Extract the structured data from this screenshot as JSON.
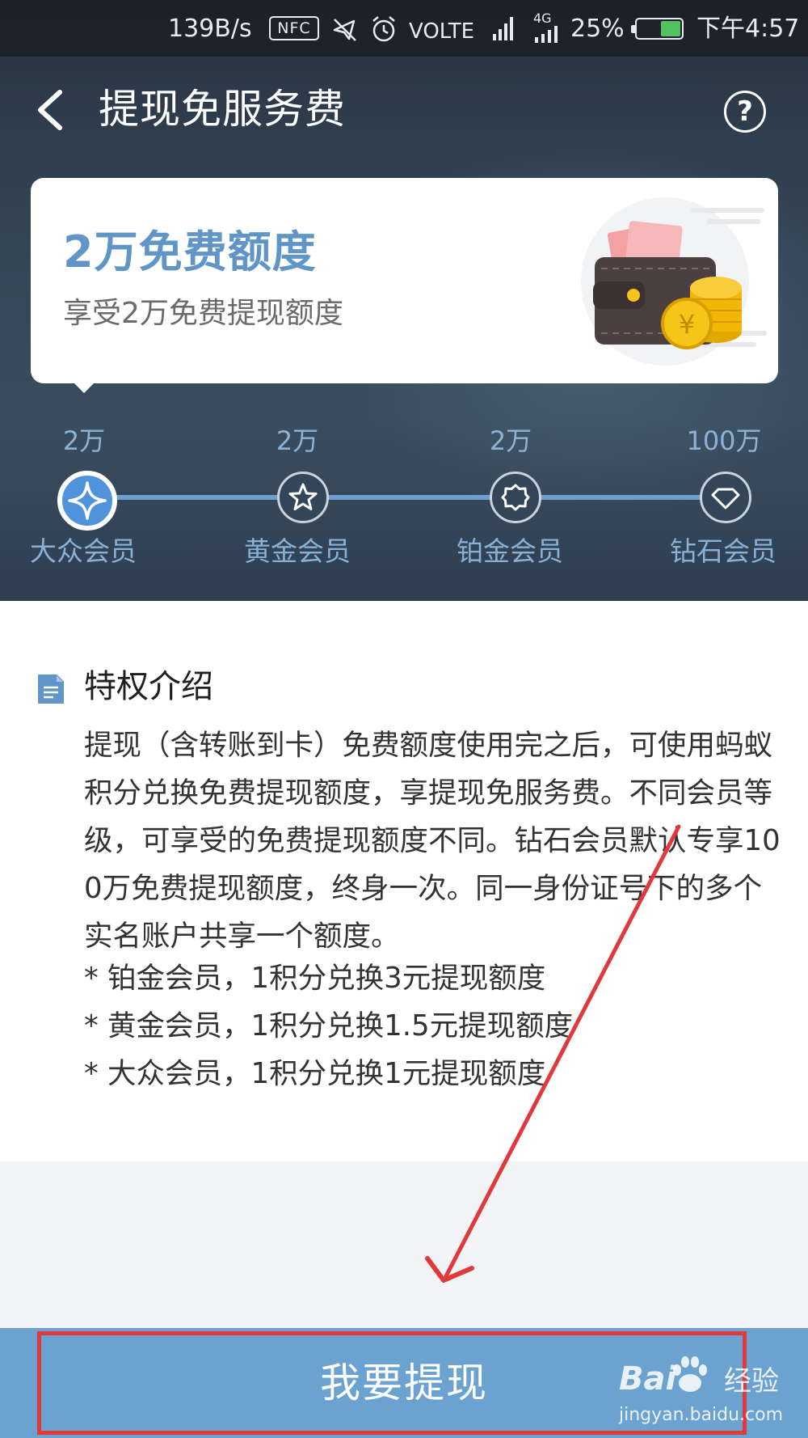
{
  "status_bar": {
    "speed": "139B/s",
    "nfc": "NFC",
    "volte": "VOLTE",
    "network_4g": "4G",
    "battery": "25%",
    "time": "下午4:57",
    "icons": [
      "mute-icon",
      "alarm-icon",
      "signal-icon",
      "battery-icon"
    ]
  },
  "nav": {
    "back_icon": "chevron-left-icon",
    "title": "提现免服务费",
    "help": "?"
  },
  "quota_card": {
    "title": "2万免费额度",
    "subtitle": "享受2万免费提现额度",
    "illustration": "wallet-coins-illustration"
  },
  "levels": [
    {
      "amount": "2万",
      "name": "大众会员",
      "icon": "sparkle-icon",
      "active": true
    },
    {
      "amount": "2万",
      "name": "黄金会员",
      "icon": "star-icon",
      "active": false
    },
    {
      "amount": "2万",
      "name": "铂金会员",
      "icon": "badge-icon",
      "active": false
    },
    {
      "amount": "100万",
      "name": "钻石会员",
      "icon": "diamond-icon",
      "active": false
    }
  ],
  "intro": {
    "icon": "document-icon",
    "heading": "特权介绍",
    "paragraph": "提现（含转账到卡）免费额度使用完之后，可使用蚂蚁积分兑换免费提现额度，享提现免服务费。不同会员等级，可享受的免费提现额度不同。钻石会员默认专享100万免费提现额度，终身一次。同一身份证号下的多个实名账户共享一个额度。",
    "items": [
      "* 铂金会员，1积分兑换3元提现额度",
      "* 黄金会员，1积分兑换1.5元提现额度",
      "* 大众会员，1积分兑换1元提现额度"
    ]
  },
  "button": {
    "label": "我要提现"
  },
  "watermark": {
    "logo_left": "Bai",
    "logo_right": "经验",
    "url": "jingyan.baidu.com"
  },
  "colors": {
    "accent": "#5f95c7",
    "button": "#6ca2cf",
    "annotation_red": "#e0393b",
    "hero_bg": "#344556"
  }
}
